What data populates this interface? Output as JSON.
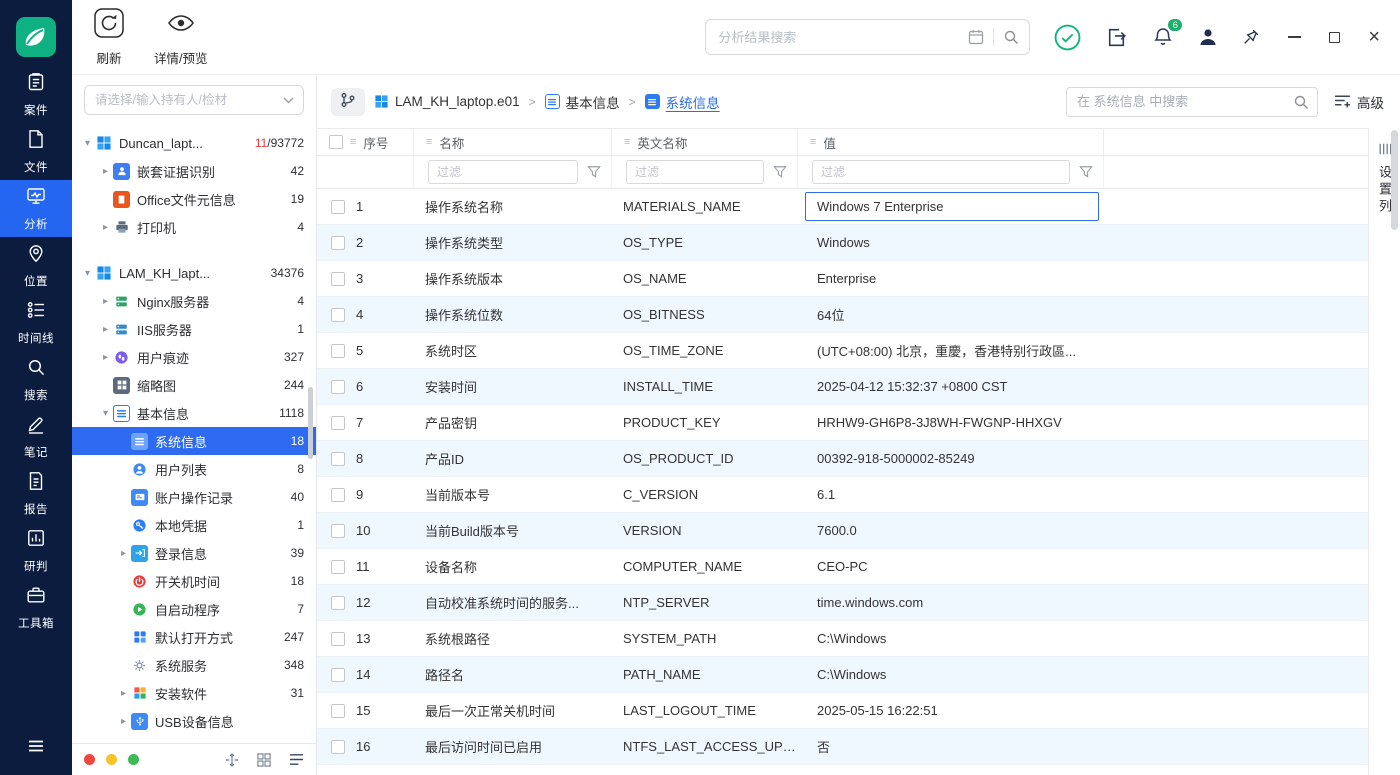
{
  "colors": {
    "sidebar_bg": "#0b1c3e",
    "nav_active": "#2566f0",
    "accent_blue": "#2e6bf0",
    "row_stripe": "#f0f8ff",
    "success_green": "#0db57c",
    "badge_green": "#18b26b",
    "count_red": "#e23d3d"
  },
  "sidebar": {
    "items": [
      {
        "label": "案件"
      },
      {
        "label": "文件"
      },
      {
        "label": "分析"
      },
      {
        "label": "位置"
      },
      {
        "label": "时间线"
      },
      {
        "label": "搜索"
      },
      {
        "label": "笔记"
      },
      {
        "label": "报告"
      },
      {
        "label": "研判"
      },
      {
        "label": "工具箱"
      }
    ]
  },
  "toolbar": {
    "refresh_label": "刷新",
    "preview_label": "详情/预览",
    "search_placeholder": "分析结果搜索",
    "bell_badge": "6",
    "close_glyph": "×"
  },
  "tree": {
    "search_placeholder": "请选择/输入持有人/检材",
    "items": [
      {
        "label": "Duncan_lapt...",
        "count_red": "11",
        "count": "/93772"
      },
      {
        "label": "嵌套证据识别",
        "count": "42"
      },
      {
        "label": "Office文件元信息",
        "count": "19"
      },
      {
        "label": "打印机",
        "count": "4"
      },
      {
        "label": "LAM_KH_lapt...",
        "count": "34376"
      },
      {
        "label": "Nginx服务器",
        "count": "4"
      },
      {
        "label": "IIS服务器",
        "count": "1"
      },
      {
        "label": "用户痕迹",
        "count": "327"
      },
      {
        "label": "缩略图",
        "count": "244"
      },
      {
        "label": "基本信息",
        "count": "1118"
      },
      {
        "label": "系统信息",
        "count": "18"
      },
      {
        "label": "用户列表",
        "count": "8"
      },
      {
        "label": "账户操作记录",
        "count": "40"
      },
      {
        "label": "本地凭据",
        "count": "1"
      },
      {
        "label": "登录信息",
        "count": "39"
      },
      {
        "label": "开关机时间",
        "count": "18"
      },
      {
        "label": "自启动程序",
        "count": "7"
      },
      {
        "label": "默认打开方式",
        "count": "247"
      },
      {
        "label": "系统服务",
        "count": "348"
      },
      {
        "label": "安装软件",
        "count": "31"
      },
      {
        "label": "USB设备信息",
        "count": ""
      }
    ]
  },
  "breadcrumb": {
    "root": "LAM_KH_laptop.e01",
    "mid": "基本信息",
    "leaf": "系统信息"
  },
  "content_search": {
    "placeholder": "在 系统信息 中搜索",
    "advanced_label": "高级"
  },
  "table": {
    "columns": {
      "no": "序号",
      "name": "名称",
      "en": "英文名称",
      "value": "值"
    },
    "filter_placeholder": "过滤",
    "rows": [
      {
        "no": "1",
        "name": "操作系统名称",
        "en": "MATERIALS_NAME",
        "value": "Windows 7 Enterprise"
      },
      {
        "no": "2",
        "name": "操作系统类型",
        "en": "OS_TYPE",
        "value": "Windows"
      },
      {
        "no": "3",
        "name": "操作系统版本",
        "en": "OS_NAME",
        "value": "Enterprise"
      },
      {
        "no": "4",
        "name": "操作系统位数",
        "en": "OS_BITNESS",
        "value": "64位"
      },
      {
        "no": "5",
        "name": "系统时区",
        "en": "OS_TIME_ZONE",
        "value": "(UTC+08:00) 北京，重慶，香港特别行政區..."
      },
      {
        "no": "6",
        "name": "安装时间",
        "en": "INSTALL_TIME",
        "value": "2025-04-12 15:32:37 +0800 CST"
      },
      {
        "no": "7",
        "name": "产品密钥",
        "en": "PRODUCT_KEY",
        "value": "HRHW9-GH6P8-3J8WH-FWGNP-HHXGV"
      },
      {
        "no": "8",
        "name": "产品ID",
        "en": "OS_PRODUCT_ID",
        "value": "00392-918-5000002-85249"
      },
      {
        "no": "9",
        "name": "当前版本号",
        "en": "C_VERSION",
        "value": "6.1"
      },
      {
        "no": "10",
        "name": "当前Build版本号",
        "en": "VERSION",
        "value": "7600.0"
      },
      {
        "no": "11",
        "name": "设备名称",
        "en": "COMPUTER_NAME",
        "value": "CEO-PC"
      },
      {
        "no": "12",
        "name": "自动校准系统时间的服务...",
        "en": "NTP_SERVER",
        "value": "time.windows.com"
      },
      {
        "no": "13",
        "name": "系统根路径",
        "en": "SYSTEM_PATH",
        "value": "C:\\Windows"
      },
      {
        "no": "14",
        "name": "路径名",
        "en": "PATH_NAME",
        "value": "C:\\Windows"
      },
      {
        "no": "15",
        "name": "最后一次正常关机时间",
        "en": "LAST_LOGOUT_TIME",
        "value": "2025-05-15 16:22:51"
      },
      {
        "no": "16",
        "name": "最后访问时间已启用",
        "en": "NTFS_LAST_ACCESS_UPDA...",
        "value": "否"
      }
    ]
  },
  "right_rail": {
    "label": "设置列"
  }
}
